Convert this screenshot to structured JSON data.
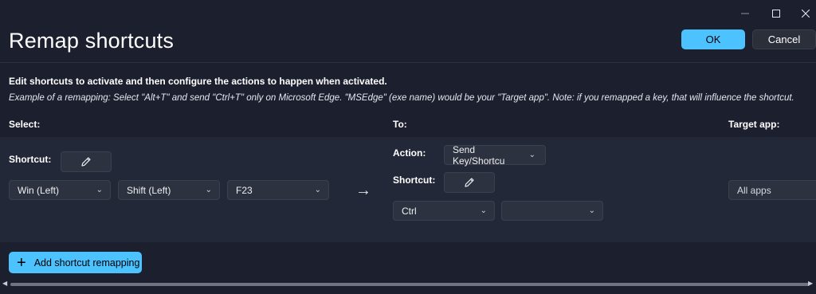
{
  "window": {
    "title": "Remap shortcuts",
    "controls": {
      "minimize_icon": "minimize-icon",
      "maximize_icon": "maximize-icon",
      "close_icon": "close-icon"
    }
  },
  "header": {
    "ok_label": "OK",
    "cancel_label": "Cancel"
  },
  "intro": {
    "description": "Edit shortcuts to activate and then configure the actions to happen when activated.",
    "example": "Example of a remapping: Select \"Alt+T\" and send \"Ctrl+T\" only on Microsoft Edge. \"MSEdge\" (exe name) would be your \"Target app\". Note: if you remapped a key, that will influence the shortcut."
  },
  "columns": {
    "select": "Select:",
    "to": "To:",
    "target_app": "Target app:"
  },
  "row": {
    "select": {
      "shortcut_label": "Shortcut:",
      "keys": [
        "Win (Left)",
        "Shift (Left)",
        "F23"
      ]
    },
    "to": {
      "action_label": "Action:",
      "action_value": "Send Key/Shortcu",
      "shortcut_label": "Shortcut:",
      "keys": [
        "Ctrl",
        ""
      ]
    },
    "target_app": {
      "value": "All apps"
    }
  },
  "footer": {
    "add_label": "Add shortcut remapping"
  },
  "colors": {
    "accent": "#4cc2ff",
    "background": "#1b1f2e",
    "panel": "#232838"
  }
}
